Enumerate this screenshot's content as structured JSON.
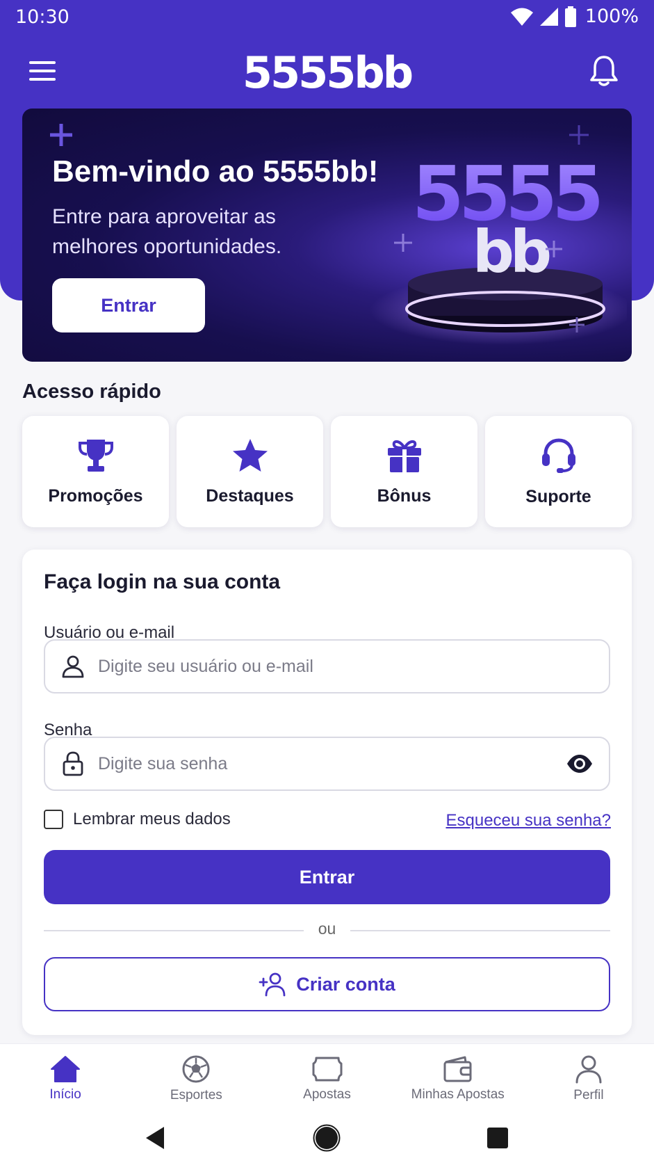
{
  "status_bar": {
    "time": "10:30",
    "battery": "100%"
  },
  "app_bar": {
    "brand": "5555bb"
  },
  "hero": {
    "title": "Bem-vindo ao 5555bb!",
    "subtitle": "Entre para aproveitar as melhores oportunidades.",
    "button_label": "Entrar",
    "art_top": "5555",
    "art_bottom": "bb"
  },
  "quick_access": {
    "title": "Acesso rápido",
    "items": [
      {
        "label": "Promoções",
        "icon": "trophy-icon"
      },
      {
        "label": "Destaques",
        "icon": "star-icon"
      },
      {
        "label": "Bônus",
        "icon": "gift-icon"
      },
      {
        "label": "Suporte",
        "icon": "headset-icon"
      }
    ]
  },
  "login": {
    "title": "Faça login na sua conta",
    "username_label": "Usuário ou e-mail",
    "username_placeholder": "Digite seu usuário ou e-mail",
    "username_value": "",
    "password_label": "Senha",
    "password_placeholder": "Digite sua senha",
    "password_value": "",
    "remember_label": "Lembrar meus dados",
    "remember_checked": false,
    "forgot_label": "Esqueceu sua senha?",
    "submit_label": "Entrar",
    "divider_text": "ou",
    "create_account_label": "Criar conta"
  },
  "bottom_nav": {
    "items": [
      {
        "label": "Início",
        "icon": "home-icon",
        "active": true
      },
      {
        "label": "Esportes",
        "icon": "soccer-ball-icon",
        "active": false
      },
      {
        "label": "Apostas",
        "icon": "ticket-icon",
        "active": false
      },
      {
        "label": "Minhas Apostas",
        "icon": "wallet-icon",
        "active": false
      },
      {
        "label": "Perfil",
        "icon": "user-icon",
        "active": false
      }
    ]
  },
  "colors": {
    "primary": "#4632c4",
    "background": "#f6f6f9",
    "hero_dark": "#170f4f"
  }
}
